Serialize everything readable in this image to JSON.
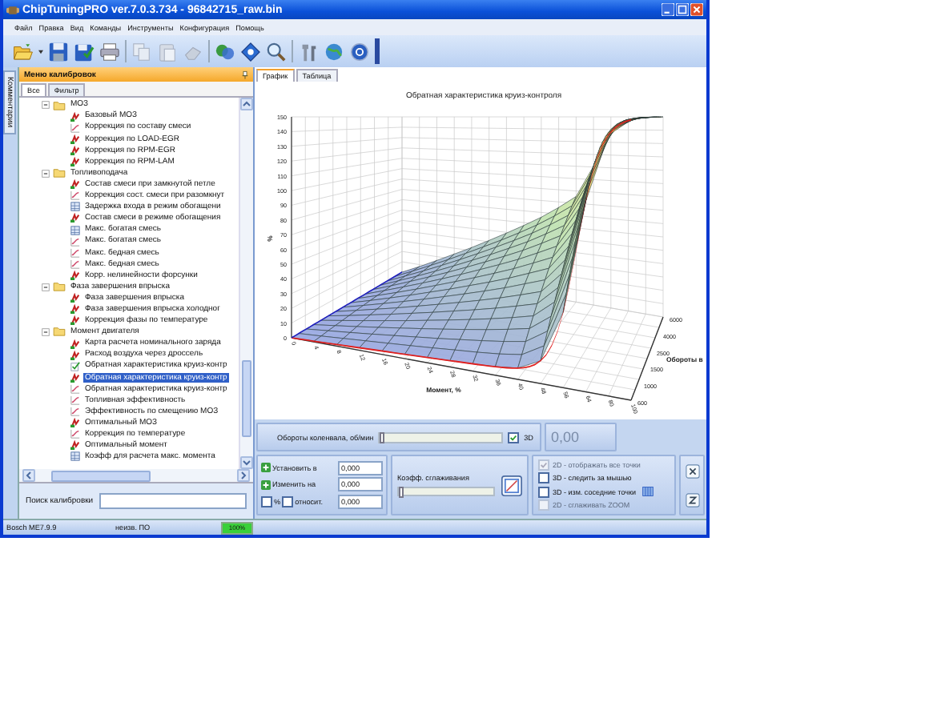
{
  "window": {
    "title": "ChipTuningPRO ver.7.0.3.734 - 96842715_raw.bin"
  },
  "menu": [
    "Файл",
    "Правка",
    "Вид",
    "Команды",
    "Инструменты",
    "Конфигурация",
    "Помощь"
  ],
  "side_tab": {
    "label": "Комментарии"
  },
  "calibration_panel": {
    "title": "Меню калибровок",
    "tabs": [
      {
        "label": "Все",
        "selected": true
      },
      {
        "label": "Фильтр",
        "selected": false
      }
    ],
    "tree": [
      {
        "label": "МОЗ",
        "expanded": true,
        "children": [
          {
            "label": "Базовый МОЗ",
            "kind": "map",
            "selected": false
          },
          {
            "label": "Коррекция по составу смеси",
            "kind": "curve",
            "selected": false
          },
          {
            "label": "Коррекция по LOAD-EGR",
            "kind": "map",
            "selected": false
          },
          {
            "label": "Коррекция по RPM-EGR",
            "kind": "map",
            "selected": false
          },
          {
            "label": "Коррекция по RPM-LAM",
            "kind": "map",
            "selected": false
          }
        ]
      },
      {
        "label": "Топливоподача",
        "expanded": true,
        "children": [
          {
            "label": "Состав смеси при замкнутой петле",
            "kind": "map",
            "selected": false
          },
          {
            "label": "Коррекция сост. смеси при разомкнут",
            "kind": "curve",
            "selected": false
          },
          {
            "label": "Задержка входа в режим обогащени",
            "kind": "table",
            "selected": false
          },
          {
            "label": "Состав смеси в режиме обогащения",
            "kind": "map",
            "selected": false
          },
          {
            "label": "Макс. богатая смесь",
            "kind": "table",
            "selected": false
          },
          {
            "label": "Макс. богатая смесь",
            "kind": "curve",
            "selected": false
          },
          {
            "label": "Макс. бедная смесь",
            "kind": "curve",
            "selected": false
          },
          {
            "label": "Макс. бедная смесь",
            "kind": "curve",
            "selected": false
          },
          {
            "label": "Корр. нелинейности форсунки",
            "kind": "map",
            "selected": false
          }
        ]
      },
      {
        "label": "Фаза завершения впрыска",
        "expanded": true,
        "children": [
          {
            "label": "Фаза завершения впрыска",
            "kind": "map",
            "selected": false
          },
          {
            "label": "Фаза завершения впрыска холодног",
            "kind": "map",
            "selected": false
          },
          {
            "label": "Коррекция фазы по температуре",
            "kind": "map",
            "selected": false
          }
        ]
      },
      {
        "label": "Момент двигателя",
        "expanded": true,
        "children": [
          {
            "label": "Карта расчета номинального заряда",
            "kind": "map",
            "selected": false
          },
          {
            "label": "Расход воздуха через дроссель",
            "kind": "map",
            "selected": false
          },
          {
            "label": "Обратная характеристика круиз-контр",
            "kind": "checked",
            "selected": false
          },
          {
            "label": "Обратная характеристика круиз-контр",
            "kind": "map",
            "selected": true
          },
          {
            "label": "Обратная характеристика круиз-контр",
            "kind": "curve",
            "selected": false
          },
          {
            "label": "Топливная эффективность",
            "kind": "curve",
            "selected": false
          },
          {
            "label": "Эффективность по смещению МОЗ",
            "kind": "curve",
            "selected": false
          },
          {
            "label": "Оптимальный МОЗ",
            "kind": "map",
            "selected": false
          },
          {
            "label": "Коррекция по температуре",
            "kind": "curve",
            "selected": false
          },
          {
            "label": "Оптимальный момент",
            "kind": "map",
            "selected": false
          },
          {
            "label": "Коэфф для расчета макс. момента",
            "kind": "table",
            "selected": false
          }
        ]
      }
    ],
    "search": {
      "label": "Поиск калибровки"
    }
  },
  "view_tabs": [
    {
      "label": "График",
      "selected": true
    },
    {
      "label": "Таблица",
      "selected": false
    }
  ],
  "chart": {
    "title": "Обратная характеристика круиз-контроля",
    "z_label": "%",
    "z_ticks": [
      "150",
      "140",
      "130",
      "120",
      "110",
      "100",
      "90",
      "80",
      "70",
      "60",
      "50",
      "40",
      "30",
      "20",
      "10",
      "0"
    ],
    "x_label": "Момент, %",
    "x_ticks": [
      "0",
      "4",
      "8",
      "12",
      "16",
      "20",
      "24",
      "28",
      "32",
      "36",
      "40",
      "48",
      "56",
      "64",
      "80",
      "100"
    ],
    "y_label": "Обороты в",
    "y_ticks": [
      "600",
      "1000",
      "1500",
      "2500",
      "4000",
      "6000"
    ]
  },
  "rpm_bar": {
    "label": "Обороты коленвала, об/мин",
    "level": 0,
    "three_d": {
      "label": "3D",
      "checked": true
    },
    "value": "0,00"
  },
  "edit": {
    "set": {
      "label": "Установить в",
      "value": "0,000"
    },
    "change": {
      "label": "Изменить на",
      "value": "0,000"
    },
    "percent": {
      "label": "%",
      "checked": false
    },
    "relative": {
      "label": "относит.",
      "checked": false,
      "value": "0,000"
    }
  },
  "smoothing": {
    "label": "Коэфф. сглаживания",
    "level": 0
  },
  "options": [
    {
      "label": "2D - отображать все точки",
      "checked": true,
      "disabled": true
    },
    {
      "label": "3D - следить за мышью",
      "checked": false,
      "disabled": false
    },
    {
      "label": "3D - изм. соседние точки",
      "checked": false,
      "disabled": false
    },
    {
      "label": "2D - сглаживать ZOOM",
      "checked": false,
      "disabled": true
    }
  ],
  "status_bar": {
    "ecu": "Bosch ME7.9.9",
    "software": "неизв. ПО",
    "progress": {
      "label": "100%",
      "level": 1
    }
  }
}
